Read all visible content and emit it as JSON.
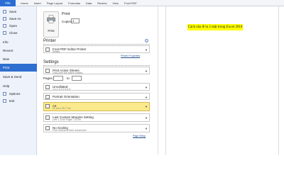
{
  "ribbon": {
    "file_tab": "File",
    "tabs": [
      "Home",
      "Insert",
      "Page Layout",
      "Formulas",
      "Data",
      "Review",
      "View",
      "Foxit PDF"
    ]
  },
  "sidebar": {
    "items": [
      {
        "label": "Save",
        "icon": "save-icon"
      },
      {
        "label": "Save As",
        "icon": "save-as-icon"
      },
      {
        "label": "Open",
        "icon": "open-folder-icon"
      },
      {
        "label": "Close",
        "icon": "close-file-icon"
      },
      {
        "label": "Info"
      },
      {
        "label": "Recent"
      },
      {
        "label": "New"
      },
      {
        "label": "Print"
      },
      {
        "label": "Save & Send"
      },
      {
        "label": "Help"
      },
      {
        "label": "Options",
        "icon": "options-icon"
      },
      {
        "label": "Exit",
        "icon": "exit-icon"
      }
    ]
  },
  "print": {
    "title": "Print",
    "button_label": "Print",
    "copies_label": "Copies:",
    "copies_value": "1"
  },
  "printer": {
    "section_title": "Printer",
    "name": "Foxit PDF Editor Printer",
    "status": "Ready",
    "properties_link": "Printer Properties"
  },
  "settings": {
    "section_title": "Settings",
    "print_what": {
      "main": "Print Active Sheets",
      "sub": "Only print the active sheets"
    },
    "pages_label": "Pages:",
    "to_label": "to",
    "collation": {
      "main": "Uncollated",
      "sub": "1,1,1   2,2,2   3,3,3"
    },
    "orientation": {
      "main": "Portrait Orientation",
      "sub": ""
    },
    "paper": {
      "main": "A4",
      "sub": "21 cm x 29.7 cm"
    },
    "margins": {
      "main": "Last Custom Margins Setting",
      "sub": "Left: 1.8 cm   Right: 1.8 cm"
    },
    "scaling": {
      "main": "No Scaling",
      "sub": "Print sheets at their actual size"
    },
    "page_setup_link": "Page Setup"
  },
  "preview": {
    "highlight_text": "Cách căn lề in 2 mặt trong Excel 2010"
  }
}
